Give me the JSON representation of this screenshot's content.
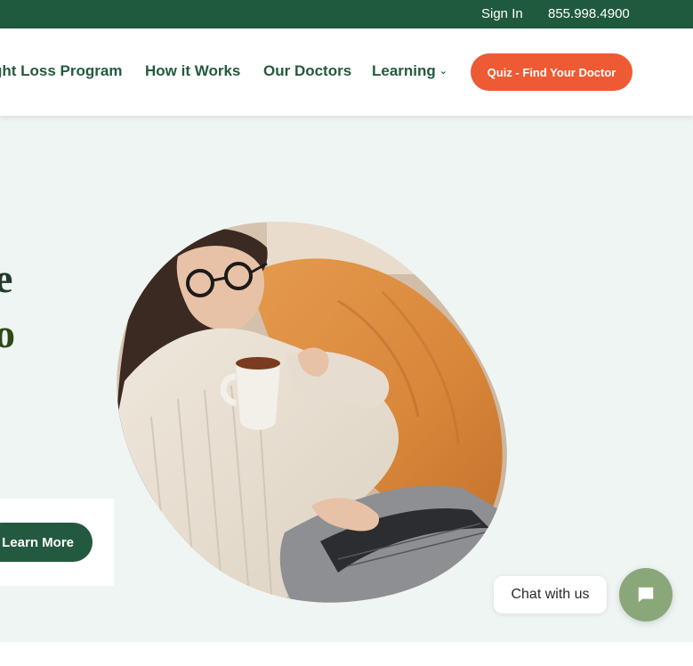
{
  "topbar": {
    "signin_label": "Sign In",
    "phone": "855.998.4900"
  },
  "nav": {
    "items": [
      {
        "label": "ght Loss Program"
      },
      {
        "label": "How it Works"
      },
      {
        "label": "Our Doctors"
      },
      {
        "label": "Learning",
        "icon": "chevron-down-icon"
      }
    ],
    "cta_label": "Quiz - Find Your Doctor"
  },
  "hero": {
    "headline_fragment_1": "e",
    "headline_fragment_2": "o",
    "button_label": "Learn More",
    "image_description_icon": "woman-with-laptop-photo"
  },
  "chat": {
    "label": "Chat with us",
    "icon": "chat-bubble-icon"
  },
  "colors": {
    "brand_green": "#1f5a3e",
    "accent_orange": "#ee5a34",
    "hero_bg": "#eff5f2",
    "chat_green": "#8aa77a"
  }
}
